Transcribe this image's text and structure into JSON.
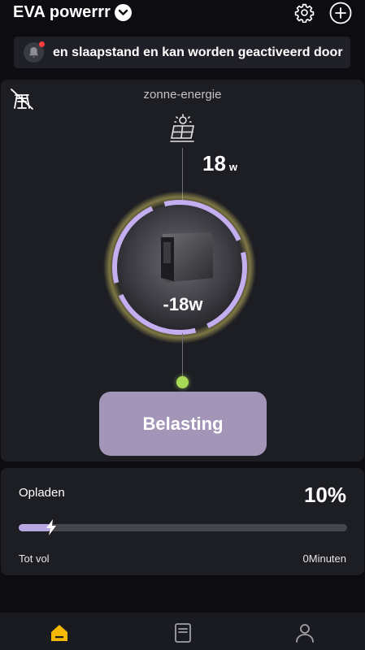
{
  "header": {
    "title": "EVA powerrr",
    "icons": [
      "chevron-down-icon",
      "gear-icon",
      "plus-circle-icon"
    ]
  },
  "notice": {
    "icon": "bell-icon",
    "text": "en slaapstand en kan worden geactiveerd door"
  },
  "energy_flow": {
    "source_label": "zonne-energie",
    "solar_value": "18",
    "solar_unit": "w",
    "battery_power": "-18w",
    "load_label": "Belasting"
  },
  "charging": {
    "label": "Opladen",
    "percent_text": "10%",
    "percent": 10,
    "full_label": "Tot vol",
    "full_value": "0Minuten"
  },
  "tabs": [
    {
      "icon": "home-icon",
      "active": true
    },
    {
      "icon": "device-icon",
      "active": false
    },
    {
      "icon": "profile-icon",
      "active": false
    }
  ],
  "colors": {
    "accent_purple": "#b9a7e2",
    "load_box": "#a395b8",
    "active_tab": "#f5b800",
    "status_green": "#a8d957",
    "notice_dot": "#ff3b3b"
  }
}
